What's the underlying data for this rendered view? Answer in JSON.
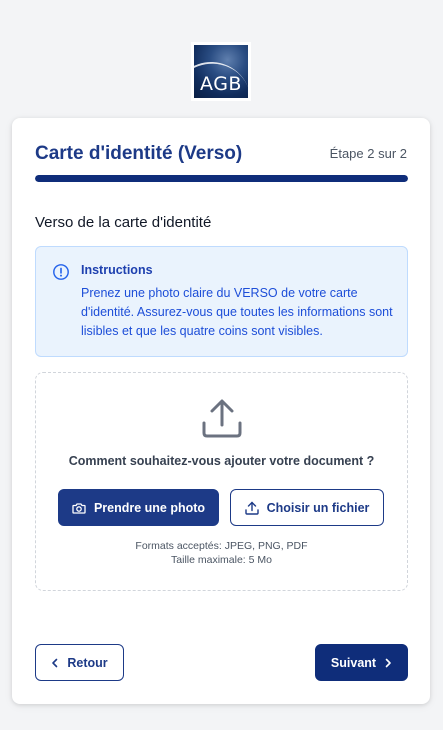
{
  "logo": {
    "text": "AGB"
  },
  "header": {
    "title": "Carte d'identité (Verso)",
    "step": "Étape 2 sur 2",
    "progress_fraction": 1.0
  },
  "section": {
    "title": "Verso de la carte d'identité"
  },
  "instructions": {
    "icon": "info-circle-icon",
    "title": "Instructions",
    "body": "Prenez une photo claire du VERSO de votre carte d'identité. Assurez-vous que toutes les informations sont lisibles et que les quatre coins sont visibles."
  },
  "upload": {
    "icon": "upload-icon",
    "question": "Comment souhaitez-vous ajouter votre document ?",
    "photo_button": {
      "label": "Prendre une photo",
      "icon": "camera-icon"
    },
    "file_button": {
      "label": "Choisir un fichier",
      "icon": "upload-icon"
    },
    "formats": "Formats acceptés: JPEG, PNG, PDF",
    "max_size": "Taille maximale: 5 Mo"
  },
  "footer": {
    "back_label": "Retour",
    "back_icon": "chevron-left-icon",
    "next_label": "Suivant",
    "next_icon": "chevron-right-icon"
  },
  "colors": {
    "primary": "#1d3a87",
    "primary_dark": "#0f2d7a",
    "info_bg": "#eaf3fd",
    "info_border": "#bfdbfe",
    "info_text": "#1d4ed8",
    "page_bg": "#f3f4f6"
  }
}
